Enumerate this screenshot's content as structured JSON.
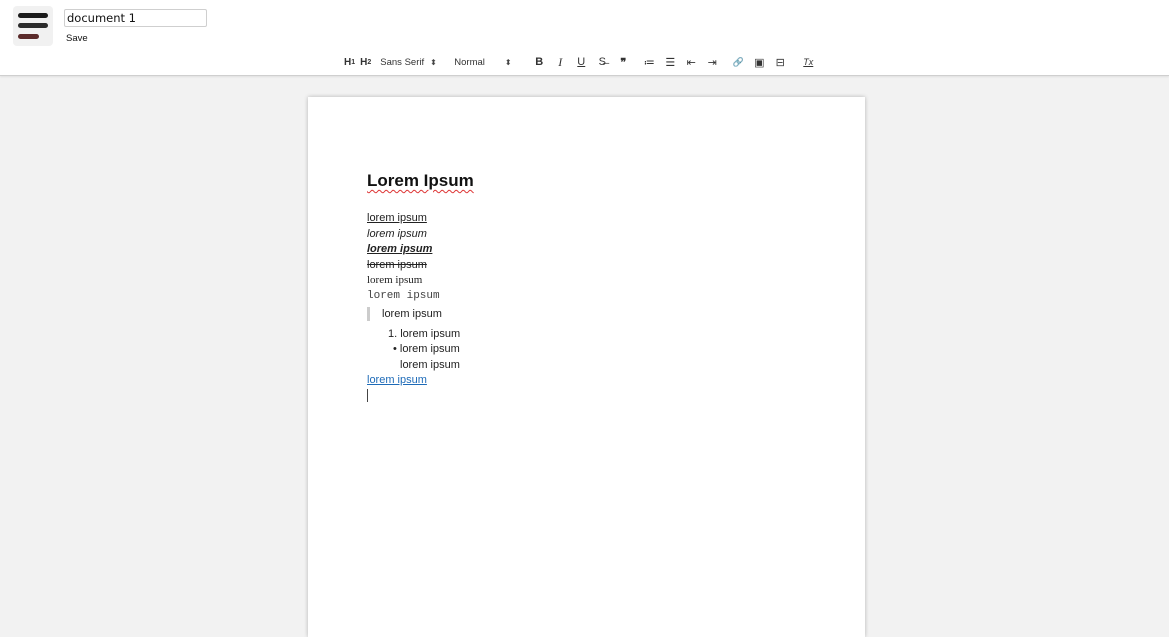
{
  "header": {
    "logo_icon": "app-logo-stacked-bars",
    "document_title_value": "document 1",
    "save_label": "Save"
  },
  "toolbar": {
    "h1_label": "H",
    "h1_sub": "1",
    "h2_label": "H",
    "h2_sub": "2",
    "font_picker_value": "Sans Serif",
    "size_picker_value": "Normal",
    "picker_arrows": "⬍",
    "bold_label": "B",
    "italic_label": "I",
    "underline_label": "U",
    "strike_icon": "strikethrough-icon",
    "strike_glyph": "S̶",
    "blockquote_glyph": "❞",
    "ordered_list_glyph": "≔",
    "bullet_list_glyph": "☰",
    "indent_decrease_glyph": "⇤",
    "indent_increase_glyph": "⇥",
    "link_glyph": "🔗",
    "image_glyph": "▣",
    "video_glyph": "⊟",
    "clean_glyph": "Tx"
  },
  "editor": {
    "heading": "Lorem Ipsum",
    "lines": {
      "underline": "lorem ipsum",
      "italic": "lorem ipsum",
      "bold_italic_underline": "lorem ipsum",
      "strike": "lorem ipsum",
      "serif": "lorem ipsum",
      "monospace": "lorem ipsum",
      "blockquote": "lorem ipsum",
      "ordered_item": "1. lorem ipsum",
      "bullet_item": "• lorem ipsum",
      "indented_item": "lorem ipsum",
      "link": "lorem ipsum"
    }
  },
  "colors": {
    "link": "#1e6bb8",
    "spellcheck_underline": "#d33",
    "logo_accent": "#5a2a2a"
  }
}
